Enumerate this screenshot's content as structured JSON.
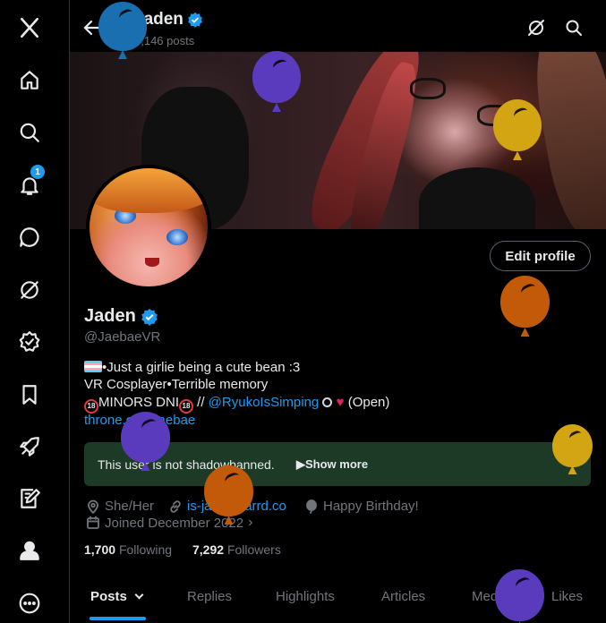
{
  "colors": {
    "accent": "#1d9bf0",
    "background": "#000000",
    "muted": "#71767b",
    "text": "#e7e9ea",
    "shadow_box": "#1c3a25"
  },
  "nav": {
    "items": [
      "x-logo-icon",
      "home-icon",
      "search-icon",
      "bell-icon",
      "chat-bubble-icon",
      "grok-icon",
      "verified-badge-icon",
      "bookmark-icon",
      "rocket-icon",
      "compose-icon",
      "person-icon",
      "more-circle-icon"
    ],
    "notification_count": "1"
  },
  "header": {
    "name": "Jaden",
    "post_count": "6,146 posts"
  },
  "profile": {
    "edit_label": "Edit profile",
    "name": "Jaden",
    "handle": "@JaebaeVR",
    "bio_line1": "•Just a girlie being a cute bean :3",
    "bio_line2": "VR Cosplayer•Terrible memory",
    "bio_line3_a": "MINORS DNI",
    "bio_line3_b": " // ",
    "bio_line3_mention": "@RyukoIsSimping",
    "bio_line3_c": " (Open)",
    "bio_link": "throne.com/jaebae"
  },
  "shadowban": {
    "text": "This user is not shadowbanned.",
    "show_more": "Show more"
  },
  "meta": {
    "pronouns": "She/Her",
    "website": "is-jaden.carrd.co",
    "birthday": "Happy Birthday!",
    "joined": "Joined December 2022"
  },
  "stats": {
    "following_count": "1,700",
    "following_label": "Following",
    "followers_count": "7,292",
    "followers_label": "Followers"
  },
  "tabs": [
    "Posts",
    "Replies",
    "Highlights",
    "Articles",
    "Media",
    "Likes"
  ],
  "balloons": [
    {
      "color": "#1a6fb0"
    },
    {
      "color": "#5b3bbd"
    },
    {
      "color": "#d4a512"
    },
    {
      "color": "#c35a0a"
    },
    {
      "color": "#5b3bbd"
    },
    {
      "color": "#c35a0a"
    },
    {
      "color": "#d4a512"
    },
    {
      "color": "#5b3bbd"
    }
  ]
}
